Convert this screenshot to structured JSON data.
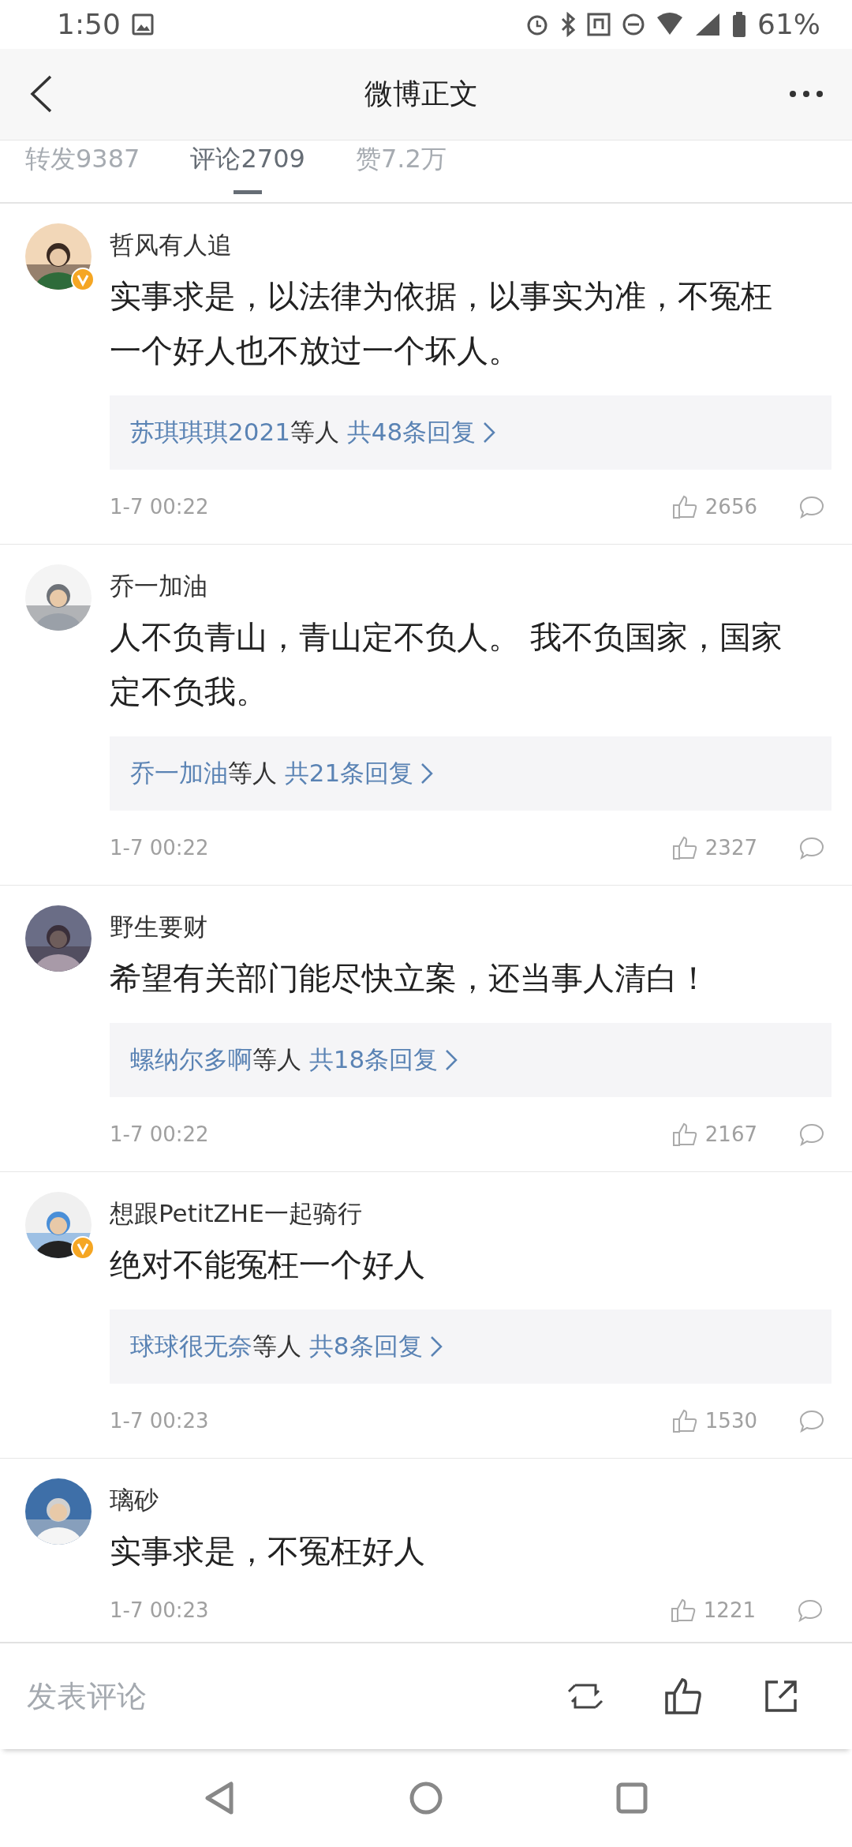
{
  "status_bar": {
    "time": "1:50",
    "battery": "61%"
  },
  "header": {
    "title": "微博正文"
  },
  "tabs": [
    {
      "label": "转发9387",
      "selected": false
    },
    {
      "label": "评论2709",
      "selected": true
    },
    {
      "label": "赞7.2万",
      "selected": false
    }
  ],
  "comments": [
    {
      "user": "哲风有人追",
      "verified": true,
      "text": "实事求是，以法律为依据，以事实为准，不冤枉一个好人也不放过一个坏人。",
      "reply": {
        "names": "苏琪琪琪2021",
        "suffix": "等人",
        "count": "共48条回复"
      },
      "time": "1-7 00:22",
      "likes": "2656"
    },
    {
      "user": "乔一加油",
      "verified": false,
      "text": "人不负青山，青山定不负人。 我不负国家，国家定不负我。",
      "reply": {
        "names": "乔一加油",
        "suffix": "等人",
        "count": "共21条回复"
      },
      "time": "1-7 00:22",
      "likes": "2327"
    },
    {
      "user": "野生要财",
      "verified": false,
      "text": "希望有关部门能尽快立案，还当事人清白！",
      "reply": {
        "names": "螺纳尔多啊",
        "suffix": "等人",
        "count": "共18条回复"
      },
      "time": "1-7 00:22",
      "likes": "2167"
    },
    {
      "user": "想跟PetitZHE一起骑行",
      "verified": true,
      "text": "绝对不能冤枉一个好人",
      "reply": {
        "names": "球球很无奈",
        "suffix": "等人",
        "count": "共8条回复"
      },
      "time": "1-7 00:23",
      "likes": "1530"
    },
    {
      "user": "璃砂",
      "verified": false,
      "text": "实事求是，不冤枉好人",
      "time": "1-7 00:23",
      "likes": "1221"
    }
  ],
  "composer": {
    "placeholder": "发表评论"
  }
}
